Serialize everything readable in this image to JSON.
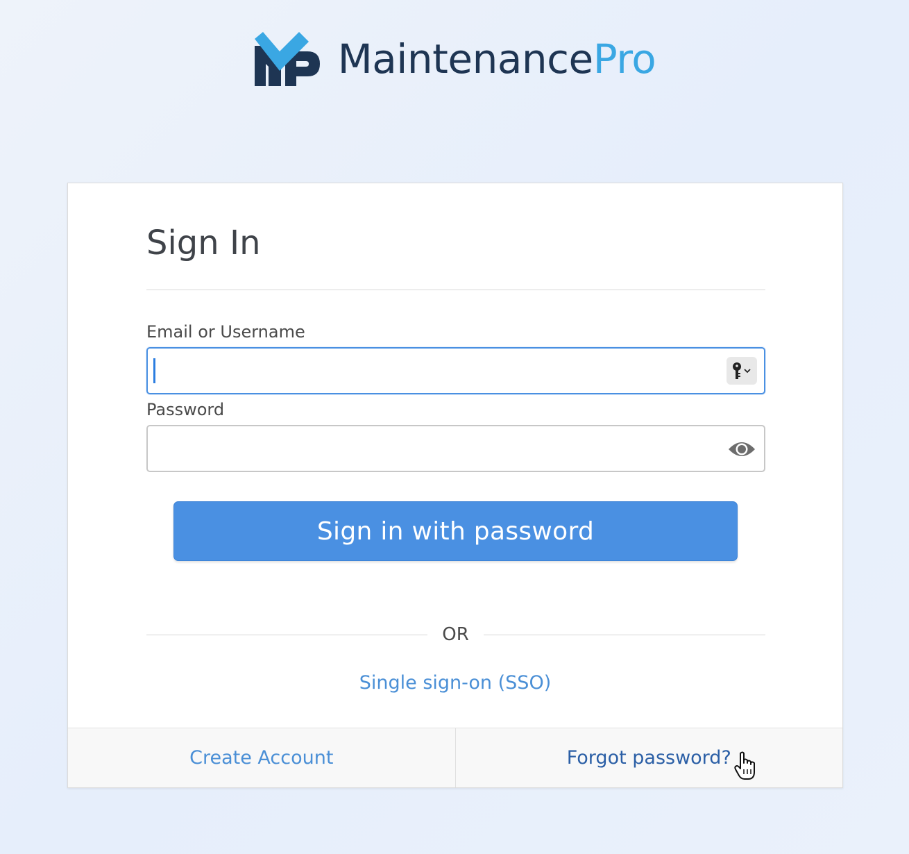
{
  "brand": {
    "name_part1": "Maintenance",
    "name_part2": "Pro",
    "colors": {
      "dark": "#1e3553",
      "light": "#3aa7e3"
    }
  },
  "signin": {
    "title": "Sign In",
    "email_label": "Email or Username",
    "email_value": "",
    "password_label": "Password",
    "password_value": "",
    "submit_label": "Sign in with password",
    "or_label": "OR",
    "sso_label": "Single sign-on (SSO)"
  },
  "footer": {
    "create_account_label": "Create Account",
    "forgot_password_label": "Forgot password?"
  },
  "icons": {
    "key": "key-icon",
    "eye": "eye-icon",
    "cursor": "hand-pointer-icon"
  },
  "colors": {
    "accent": "#4a90e2",
    "link": "#4a8fd6",
    "link_dark": "#2b5fa6"
  }
}
